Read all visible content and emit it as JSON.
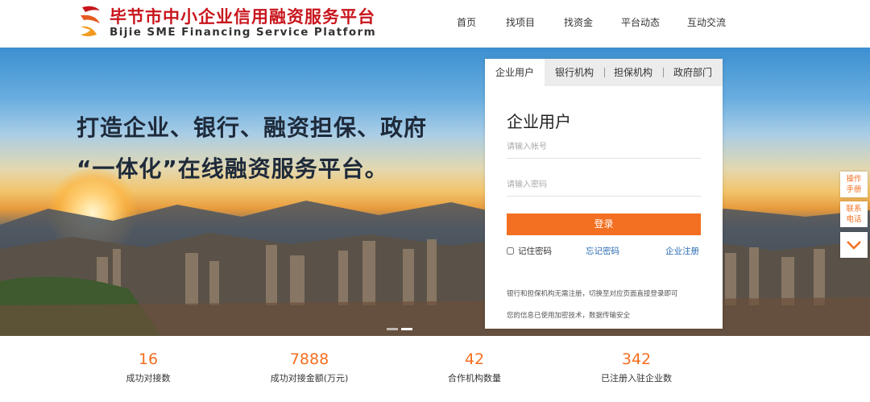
{
  "header": {
    "logo_cn": "毕节市中小企业信用融资服务平台",
    "logo_en": "Bijie SME Financing Service Platform",
    "brand_color": "#c8161d",
    "nav": [
      {
        "label": "首页"
      },
      {
        "label": "找项目"
      },
      {
        "label": "找资金"
      },
      {
        "label": "平台动态"
      },
      {
        "label": "互动交流"
      }
    ]
  },
  "hero": {
    "line1": "打造企业、银行、融资担保、政府",
    "line2": "“一体化”在线融资服务平台。"
  },
  "login": {
    "tabs": [
      {
        "label": "企业用户",
        "active": true
      },
      {
        "label": "银行机构"
      },
      {
        "label": "担保机构"
      },
      {
        "label": "政府部门"
      }
    ],
    "title": "企业用户",
    "account_placeholder": "请输入帐号",
    "password_placeholder": "请输入密码",
    "login_button": "登录",
    "remember_label": "记住密码",
    "forgot_link": "忘记密码",
    "register_link": "企业注册",
    "note1": "银行和担保机构无需注册，切换至对应页面直接登录即可",
    "note2": "您的信息已使用加密技术，数据传输安全",
    "accent_color": "#f36f21"
  },
  "side": {
    "manual": "操作手册",
    "contact": "联系电话",
    "arrow_icon": "chevron-down-icon"
  },
  "stats": [
    {
      "value": "16",
      "label": "成功对接数"
    },
    {
      "value": "7888",
      "label": "成功对接金额(万元)"
    },
    {
      "value": "42",
      "label": "合作机构数量"
    },
    {
      "value": "342",
      "label": "已注册入驻企业数"
    }
  ]
}
